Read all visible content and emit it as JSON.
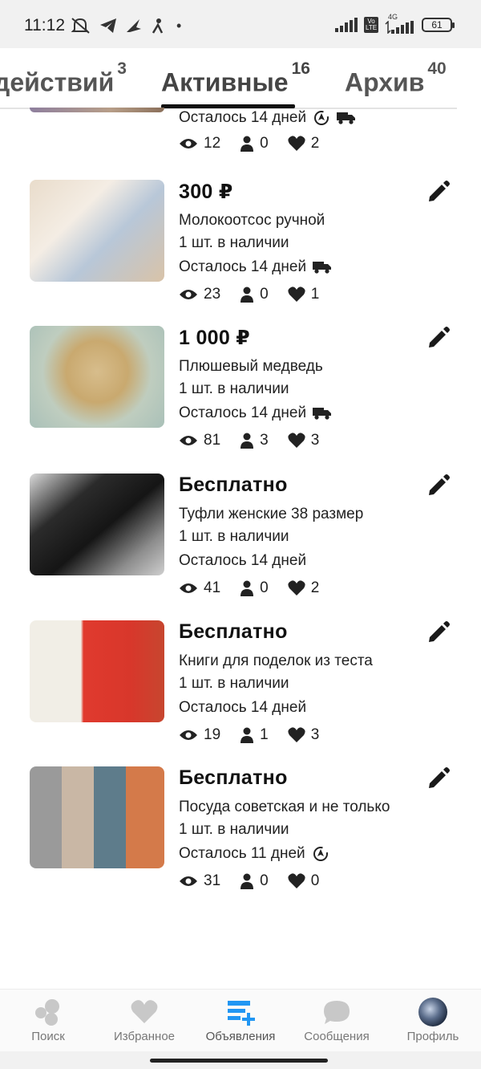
{
  "status_bar": {
    "time": "11:12",
    "battery": "61",
    "network": "4G",
    "volte": "Vo LTE"
  },
  "tabs": [
    {
      "label": "действий",
      "count": "3"
    },
    {
      "label": "Активные",
      "count": "16"
    },
    {
      "label": "Архив",
      "count": "40"
    }
  ],
  "active_tab": "Активные",
  "partial_listing": {
    "remaining": "Осталось 14 дней",
    "views": "12",
    "contacts": "0",
    "favorites": "2"
  },
  "listings": [
    {
      "price": "300 ₽",
      "title": "Молокоотсос ручной",
      "stock": "1 шт. в наличии",
      "remaining": "Осталось 14 дней",
      "delivery": true,
      "auto_renew": false,
      "views": "23",
      "contacts": "0",
      "favorites": "1",
      "thumb_icon": "breast-pump-box-photo"
    },
    {
      "price": "1 000 ₽",
      "title": "Плюшевый медведь",
      "stock": "1 шт. в наличии",
      "remaining": "Осталось 14 дней",
      "delivery": true,
      "auto_renew": false,
      "views": "81",
      "contacts": "3",
      "favorites": "3",
      "thumb_icon": "teddy-bear-photo"
    },
    {
      "price": "Бесплатно",
      "title": "Туфли женские 38 размер",
      "stock": "1 шт. в наличии",
      "remaining": "Осталось 14 дней",
      "delivery": false,
      "auto_renew": false,
      "views": "41",
      "contacts": "0",
      "favorites": "2",
      "thumb_icon": "black-heels-photo"
    },
    {
      "price": "Бесплатно",
      "title": "Книги для поделок из теста",
      "stock": "1 шт. в наличии",
      "remaining": "Осталось 14 дней",
      "delivery": false,
      "auto_renew": false,
      "views": "19",
      "contacts": "1",
      "favorites": "3",
      "thumb_icon": "craft-books-photo"
    },
    {
      "price": "Бесплатно",
      "title": "Посуда советская и не только",
      "stock": "1 шт. в наличии",
      "remaining": "Осталось 11 дней",
      "delivery": false,
      "auto_renew": true,
      "views": "31",
      "contacts": "0",
      "favorites": "0",
      "thumb_icon": "dishes-collage-photo"
    }
  ],
  "bottom_nav": [
    {
      "label": "Поиск",
      "icon": "search-blobs-icon"
    },
    {
      "label": "Избранное",
      "icon": "heart-icon"
    },
    {
      "label": "Объявления",
      "icon": "listings-add-icon",
      "active": true
    },
    {
      "label": "Сообщения",
      "icon": "chat-bubble-icon"
    },
    {
      "label": "Профиль",
      "icon": "avatar"
    }
  ],
  "colors": {
    "accent": "#2196f3",
    "nav_inactive": "#c8c8c8",
    "text": "#1a1a1a"
  }
}
